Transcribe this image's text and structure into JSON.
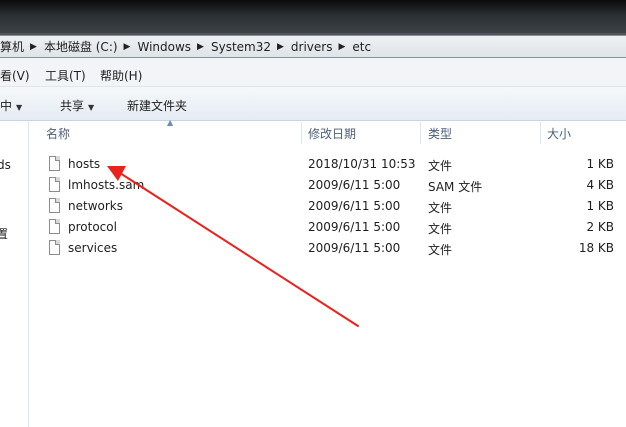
{
  "address": {
    "crumbs": [
      "算机",
      "本地磁盘 (C:)",
      "Windows",
      "System32",
      "drivers",
      "etc"
    ]
  },
  "menubar": {
    "view": "看(V)",
    "tools": "工具(T)",
    "help": "帮助(H)"
  },
  "toolbar": {
    "include": "库中",
    "share": "共享",
    "new_folder": "新建文件夹"
  },
  "nav": {
    "item1": "ds",
    "item2": "置"
  },
  "columns": {
    "name": "名称",
    "modified": "修改日期",
    "type": "类型",
    "size": "大小"
  },
  "files": [
    {
      "name": "hosts",
      "modified": "2018/10/31 10:53",
      "type": "文件",
      "size": "1 KB"
    },
    {
      "name": "lmhosts.sam",
      "modified": "2009/6/11 5:00",
      "type": "SAM 文件",
      "size": "4 KB"
    },
    {
      "name": "networks",
      "modified": "2009/6/11 5:00",
      "type": "文件",
      "size": "1 KB"
    },
    {
      "name": "protocol",
      "modified": "2009/6/11 5:00",
      "type": "文件",
      "size": "2 KB"
    },
    {
      "name": "services",
      "modified": "2009/6/11 5:00",
      "type": "文件",
      "size": "18 KB"
    }
  ],
  "annotation_color": "#e8231e"
}
